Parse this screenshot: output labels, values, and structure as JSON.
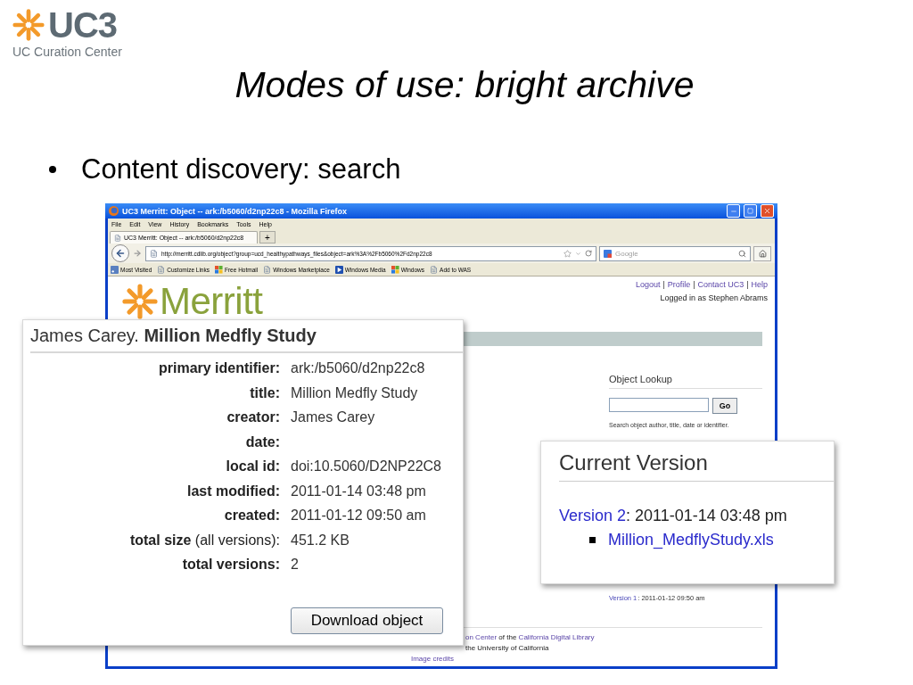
{
  "logo": {
    "mark": "UC3",
    "subtitle": "UC Curation Center"
  },
  "slide_title": "Modes of use: bright archive",
  "bullets": [
    "Content discovery: search"
  ],
  "browser": {
    "title": "UC3 Merritt: Object -- ark:/b5060/d2np22c8 - Mozilla Firefox",
    "menu": [
      "File",
      "Edit",
      "View",
      "History",
      "Bookmarks",
      "Tools",
      "Help"
    ],
    "tab": "UC3 Merritt: Object -- ark:/b5060/d2np22c8",
    "new_tab": "+",
    "url": "http://merritt.cdlib.org/object?group=ucd_healthypathways_files&object=ark%3A%2Fb5060%2Fd2np22c8",
    "search_placeholder": "Google",
    "bookmarks": [
      {
        "label": "Most Visited",
        "kind": "feed"
      },
      {
        "label": "Customize Links",
        "kind": "page"
      },
      {
        "label": "Free Hotmail",
        "kind": "windows"
      },
      {
        "label": "Windows Marketplace",
        "kind": "page"
      },
      {
        "label": "Windows Media",
        "kind": "media"
      },
      {
        "label": "Windows",
        "kind": "windows"
      },
      {
        "label": "Add to WAS",
        "kind": "page"
      }
    ]
  },
  "page": {
    "logo": "Merritt",
    "header_links": [
      "Logout",
      "|",
      "Profile",
      "|",
      "Contact UC3",
      "|",
      "Help"
    ],
    "logged_in": "Logged in as Stephen Abrams",
    "lookup": {
      "title": "Object Lookup",
      "button": "Go",
      "hint": "Search object author, title, date or identifier."
    },
    "older_version": {
      "link": "Version 1",
      "text": ": 2011-01-12 09:50 am"
    },
    "footer": {
      "line_1": [
        {
          "text": "on Center",
          "link": true
        },
        {
          "text": " of the ",
          "link": false
        },
        {
          "text": "California Digital Library",
          "link": true
        }
      ],
      "line_2": "the University of California",
      "line_3": "Image credits"
    }
  },
  "metadata_callout": {
    "author": "James Carey.",
    "title": "Million Medfly Study",
    "rows": [
      {
        "label": "primary identifier:",
        "value": "ark:/b5060/d2np22c8"
      },
      {
        "label": "title:",
        "value": "Million Medfly Study"
      },
      {
        "label": "creator:",
        "value": "James Carey"
      },
      {
        "label": "date:"
      },
      {
        "label": "local id:",
        "value": "doi:10.5060/D2NP22C8"
      },
      {
        "label": "last modified:",
        "value": "2011-01-14 03:48 pm"
      },
      {
        "label": "created:",
        "value": "2011-01-12 09:50 am"
      },
      {
        "label": "total size",
        "note": "(all versions):",
        "value": "451.2 KB"
      },
      {
        "label": "total versions:",
        "value": "2"
      }
    ],
    "button": "Download object"
  },
  "version_callout": {
    "title": "Current Version",
    "version_link": "Version 2",
    "version_date": ": 2011-01-14 03:48 pm",
    "files": [
      "Million_MedflyStudy.xls"
    ]
  }
}
